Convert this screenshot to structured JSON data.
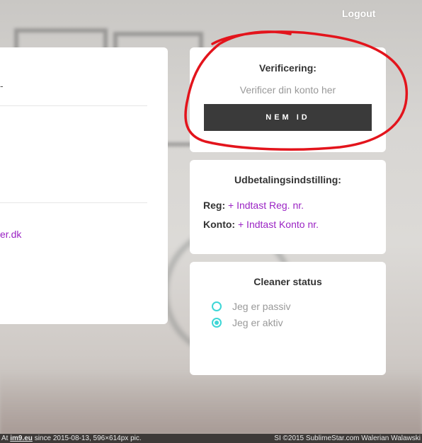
{
  "header": {
    "logout_label": "Logout"
  },
  "left_card": {
    "email_fragment": "er.dk"
  },
  "verification": {
    "title": "Verificering:",
    "subtitle": "Verificer din konto her",
    "button_label": "NEM ID"
  },
  "payout": {
    "title": "Udbetalingsindstilling:",
    "reg_label": "Reg:",
    "reg_link": "+ Indtast Reg. nr.",
    "account_label": "Konto:",
    "account_link": "+ Indtast Konto nr."
  },
  "cleaner_status": {
    "title": "Cleaner status",
    "options": [
      {
        "label": "Jeg er passiv",
        "checked": false
      },
      {
        "label": "Jeg er aktiv",
        "checked": true
      }
    ]
  },
  "footer": {
    "left_prefix": "At",
    "left_site": "im9.eu",
    "left_text": "since 2015-08-13, 596×614px pic.",
    "right_text": "SI ©2015 SublimeStar.com Walerian Walawski"
  },
  "colors": {
    "accent_link": "#9b24c4",
    "radio": "#3ed6d6",
    "annotation": "#e3141c",
    "button_bg": "#3a3a3a"
  }
}
